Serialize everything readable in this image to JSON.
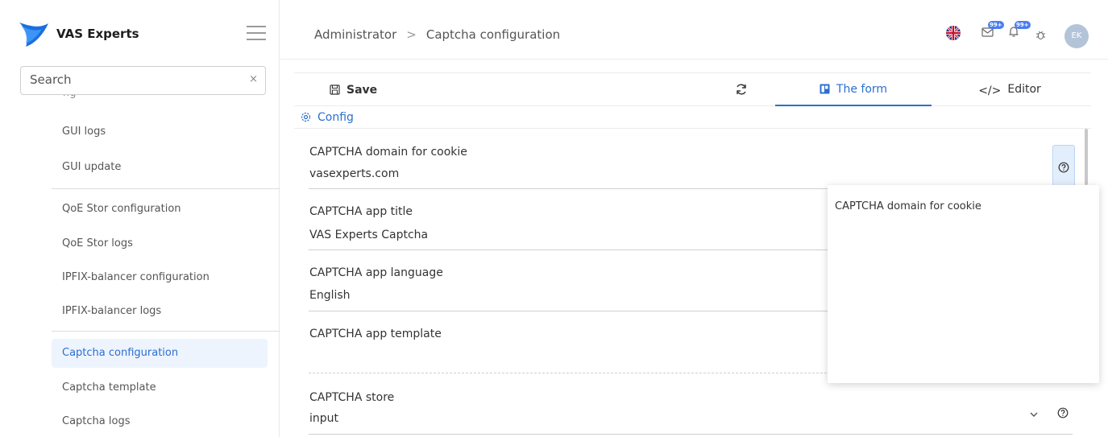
{
  "brand": {
    "name": "VAS Experts",
    "logo_color": "#1a6fe0"
  },
  "search": {
    "placeholder": "Search",
    "value": "",
    "clear": "×"
  },
  "sidebar": {
    "items": [
      {
        "label": "GUI logs"
      },
      {
        "label": "GUI update"
      },
      {
        "label": "QoE Stor configuration"
      },
      {
        "label": "QoE Stor logs"
      },
      {
        "label": "IPFIX-balancer configuration"
      },
      {
        "label": "IPFIX-balancer logs"
      },
      {
        "label": "Captcha configuration",
        "active": true
      },
      {
        "label": "Captcha template"
      },
      {
        "label": "Captcha logs"
      }
    ]
  },
  "header": {
    "breadcrumb": [
      "Administrator",
      "Captcha configuration"
    ],
    "messages_badge": "99+",
    "notifications_badge": "99+",
    "avatar_initials": "EK",
    "language_flag": "uk-flag"
  },
  "toolbar": {
    "save_label": "Save",
    "form_tab": "The form",
    "editor_tab": "Editor",
    "editor_icon": "</>"
  },
  "section": {
    "title": "Config"
  },
  "fields": [
    {
      "label": "CAPTCHA domain for cookie",
      "value": "vasexperts.com"
    },
    {
      "label": "CAPTCHA app title",
      "value": "VAS Experts Captcha"
    },
    {
      "label": "CAPTCHA app language",
      "value": "English"
    },
    {
      "label": "CAPTCHA app template",
      "value": ""
    },
    {
      "label": "CAPTCHA store",
      "value": "input"
    }
  ],
  "tooltip": {
    "text": "CAPTCHA domain for cookie"
  },
  "colors": {
    "accent": "#2a6fcf",
    "active_bg": "#eef4fd",
    "badge": "#4a7df0"
  }
}
